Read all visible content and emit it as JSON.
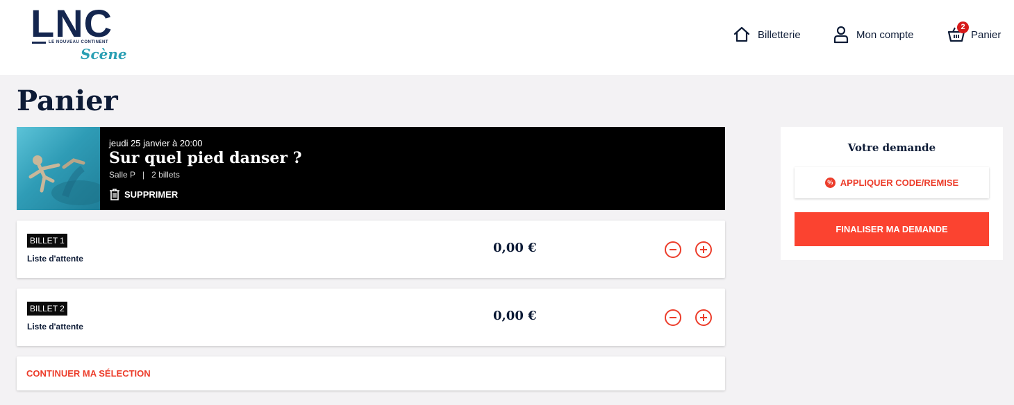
{
  "brand": {
    "logo_main": "LNC",
    "logo_sub": "LE NOUVEAU CONTINENT",
    "logo_scene": "Scène"
  },
  "nav": {
    "billetterie": "Billetterie",
    "compte": "Mon compte",
    "panier": "Panier",
    "cart_count": "2",
    "icons": [
      "home-icon",
      "user-icon",
      "basket-icon"
    ]
  },
  "page": {
    "title": "Panier"
  },
  "event": {
    "date": "jeudi 25 janvier à 20:00",
    "title": "Sur quel pied danser ?",
    "venue": "Salle P",
    "separator": "|",
    "tickets_count": "2 billets",
    "delete_label": "SUPPRIMER"
  },
  "tickets": [
    {
      "tag": "BILLET 1",
      "status": "Liste d'attente",
      "price": "0,00 €"
    },
    {
      "tag": "BILLET 2",
      "status": "Liste d'attente",
      "price": "0,00 €"
    }
  ],
  "continue_label": "CONTINUER MA SÉLECTION",
  "summary": {
    "title": "Votre demande",
    "promo_icon": "%",
    "promo_label": "APPLIQUER CODE/REMISE",
    "finalize_label": "FINALISER MA DEMANDE"
  },
  "colors": {
    "accent": "#ec3c2a",
    "navy": "#0d1b36",
    "badge": "#d61a1a",
    "teal": "#2a9fb4"
  }
}
